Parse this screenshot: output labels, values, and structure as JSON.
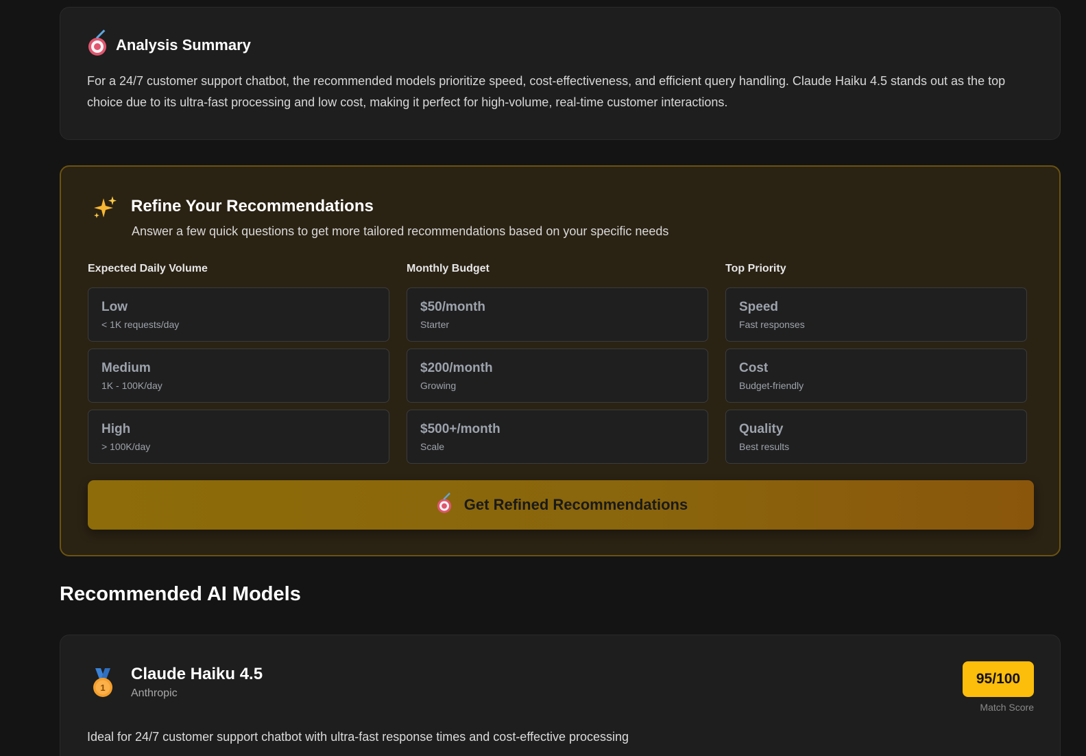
{
  "summary": {
    "icon": "target-icon",
    "title": "Analysis Summary",
    "text": "For a 24/7 customer support chatbot, the recommended models prioritize speed, cost-effectiveness, and efficient query handling. Claude Haiku 4.5 stands out as the top choice due to its ultra-fast processing and low cost, making it perfect for high-volume, real-time customer interactions."
  },
  "refine": {
    "icon": "sparkles-icon",
    "title": "Refine Your Recommendations",
    "subtitle": "Answer a few quick questions to get more tailored recommendations based on your specific needs",
    "columns": [
      {
        "label": "Expected Daily Volume",
        "options": [
          {
            "title": "Low",
            "desc": "< 1K requests/day"
          },
          {
            "title": "Medium",
            "desc": "1K - 100K/day"
          },
          {
            "title": "High",
            "desc": "> 100K/day"
          }
        ]
      },
      {
        "label": "Monthly Budget",
        "options": [
          {
            "title": "$50/month",
            "desc": "Starter"
          },
          {
            "title": "$200/month",
            "desc": "Growing"
          },
          {
            "title": "$500+/month",
            "desc": "Scale"
          }
        ]
      },
      {
        "label": "Top Priority",
        "options": [
          {
            "title": "Speed",
            "desc": "Fast responses"
          },
          {
            "title": "Cost",
            "desc": "Budget-friendly"
          },
          {
            "title": "Quality",
            "desc": "Best results"
          }
        ]
      }
    ],
    "button_label": "Get Refined Recommendations"
  },
  "models": {
    "section_title": "Recommended AI Models",
    "items": [
      {
        "rank_icon": "first-place-medal-icon",
        "name": "Claude Haiku 4.5",
        "vendor": "Anthropic",
        "score": "95/100",
        "score_label": "Match Score",
        "description": "Ideal for 24/7 customer support chatbot with ultra-fast response times and cost-effective processing"
      }
    ]
  },
  "colors": {
    "background": "#141414",
    "card": "#1e1e1e",
    "refine_bg": "#2a2213",
    "refine_border": "#6b5310",
    "accent_gold": "#fcbd0b"
  }
}
